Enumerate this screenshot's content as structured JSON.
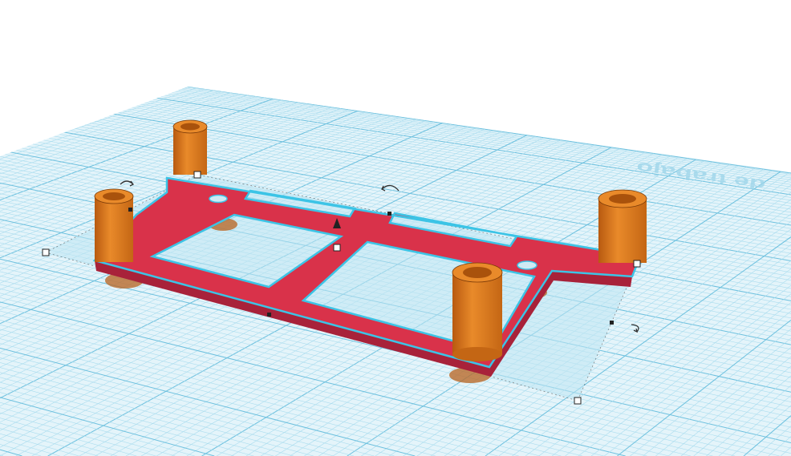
{
  "workplane": {
    "label": "de trabajo",
    "grid_color": "#8fd0e6",
    "plane_color": "#dff2f8"
  },
  "model": {
    "frame_color": "#d9324a",
    "frame_side_color": "#a8223a",
    "standoff_color": "#e07a1f",
    "selection_color": "#3cc4e6"
  }
}
